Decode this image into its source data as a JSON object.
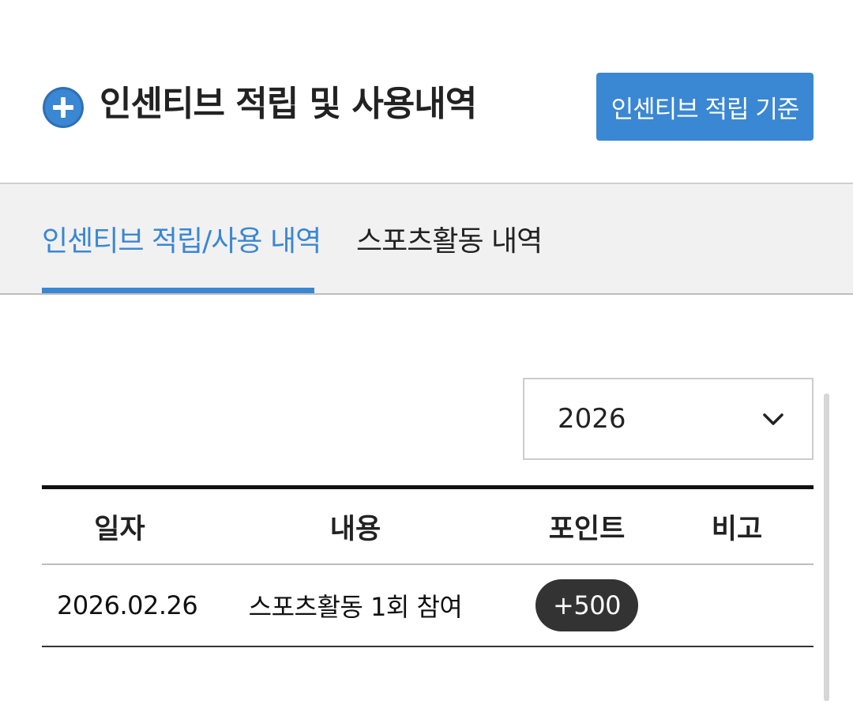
{
  "header": {
    "icon": "plus-circle-icon",
    "title": "인센티브 적립 및 사용내역",
    "criteria_button_label": "인센티브 적립 기준"
  },
  "tabs": [
    {
      "label": "인센티브 적립/사용 내역",
      "active": true
    },
    {
      "label": "스포츠활동 내역",
      "active": false
    }
  ],
  "filter": {
    "year_selected": "2026",
    "icon": "chevron-down-icon"
  },
  "table": {
    "columns": [
      "일자",
      "내용",
      "포인트",
      "비고"
    ],
    "rows": [
      {
        "date": "2026.02.26",
        "content": "스포츠활동 1회 참여",
        "points": "+500",
        "note": ""
      }
    ]
  },
  "colors": {
    "accent": "#3a87d3",
    "badge": "#333333",
    "tab_background": "#f1f1f1"
  }
}
